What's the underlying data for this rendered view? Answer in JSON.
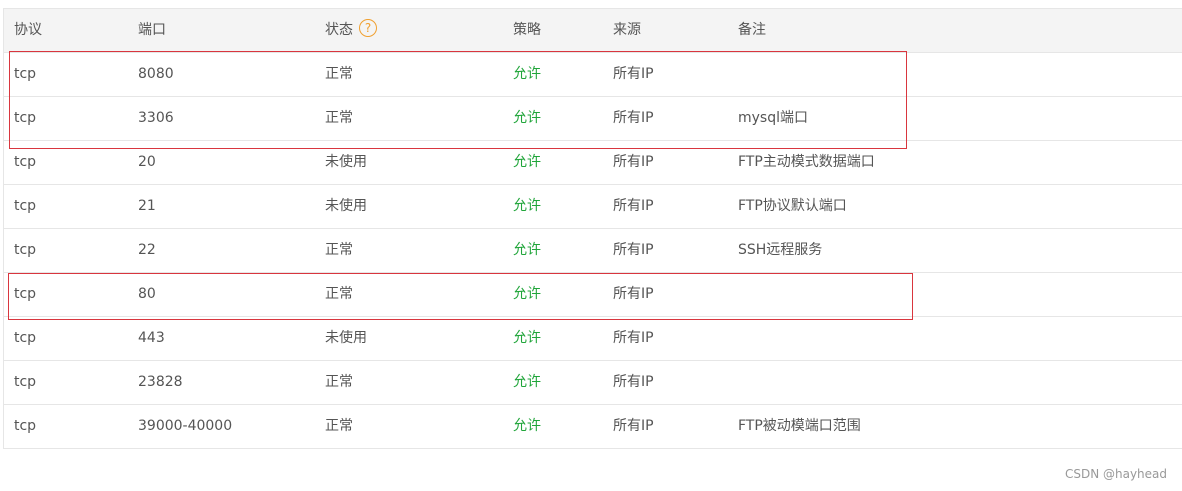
{
  "table": {
    "headers": {
      "protocol": "协议",
      "port": "端口",
      "status": "状态",
      "policy": "策略",
      "source": "来源",
      "note": "备注"
    },
    "help_icon_glyph": "?",
    "rows": [
      {
        "protocol": "tcp",
        "port": "8080",
        "status": "正常",
        "policy": "允许",
        "source": "所有IP",
        "note": ""
      },
      {
        "protocol": "tcp",
        "port": "3306",
        "status": "正常",
        "policy": "允许",
        "source": "所有IP",
        "note": "mysql端口"
      },
      {
        "protocol": "tcp",
        "port": "20",
        "status": "未使用",
        "policy": "允许",
        "source": "所有IP",
        "note": "FTP主动模式数据端口"
      },
      {
        "protocol": "tcp",
        "port": "21",
        "status": "未使用",
        "policy": "允许",
        "source": "所有IP",
        "note": "FTP协议默认端口"
      },
      {
        "protocol": "tcp",
        "port": "22",
        "status": "正常",
        "policy": "允许",
        "source": "所有IP",
        "note": "SSH远程服务"
      },
      {
        "protocol": "tcp",
        "port": "80",
        "status": "正常",
        "policy": "允许",
        "source": "所有IP",
        "note": ""
      },
      {
        "protocol": "tcp",
        "port": "443",
        "status": "未使用",
        "policy": "允许",
        "source": "所有IP",
        "note": ""
      },
      {
        "protocol": "tcp",
        "port": "23828",
        "status": "正常",
        "policy": "允许",
        "source": "所有IP",
        "note": ""
      },
      {
        "protocol": "tcp",
        "port": "39000-40000",
        "status": "正常",
        "policy": "允许",
        "source": "所有IP",
        "note": "FTP被动模端口范围"
      }
    ]
  },
  "watermark": "CSDN @hayhead",
  "colors": {
    "allow": "#20a53a",
    "help_icon": "#f0a030",
    "highlight_border": "#d9363e",
    "header_bg": "#f4f4f4"
  }
}
